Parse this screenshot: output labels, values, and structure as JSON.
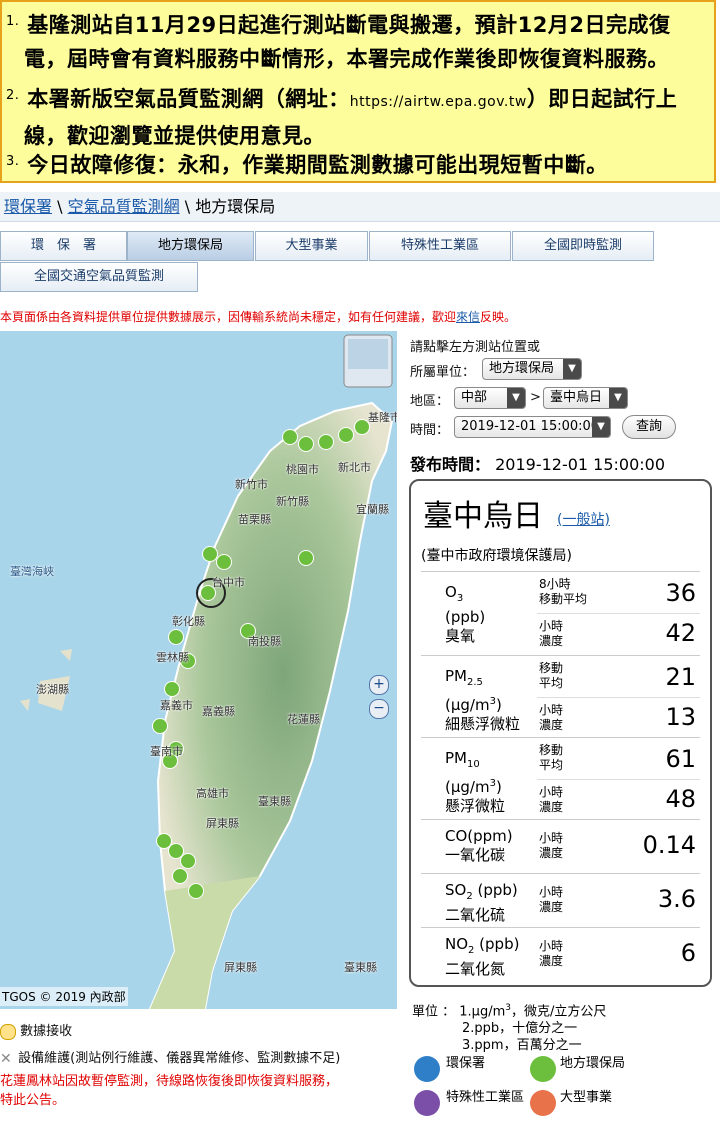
{
  "notices": [
    {
      "num": "1.",
      "line1": "基隆測站自11月29日起進行測站斷電與搬遷，預計12月2日完成復",
      "line2": "電，屆時會有資料服務中斷情形，本署完成作業後即恢復資料服務。"
    },
    {
      "num": "2.",
      "line1a": "本署新版空氣品質監測網（網址：",
      "url": "https://airtw.epa.gov.tw",
      "line1b": "）即日起試行上",
      "line2": "線，歡迎瀏覽並提供使用意見。"
    },
    {
      "num": "3.",
      "line1": "今日故障修復：永和，作業期間監測數據可能出現短暫中斷。"
    }
  ],
  "breadcrumb": {
    "item1": "環保署",
    "sep": "\\",
    "item2": "空氣品質監測網",
    "current": "地方環保局"
  },
  "tabs": [
    "環　保　署",
    "地方環保局",
    "大型事業",
    "特殊性工業區",
    "全國即時監測",
    "全國交通空氣品質監測"
  ],
  "disclaimer": {
    "text": "本頁面係由各資料提供單位提供數據展示，因傳輸系統尚未穩定，如有任何建議，歡迎",
    "link": "來信",
    "tail": "反映。"
  },
  "map": {
    "copyright": "TGOS © 2019 內政部",
    "strait": "臺灣海峽",
    "labels": [
      "基隆市",
      "桃園市",
      "新北市",
      "新竹市",
      "新竹縣",
      "宜蘭縣",
      "苗栗縣",
      "台中市",
      "彰化縣",
      "南投縣",
      "雲林縣",
      "澎湖縣",
      "嘉義市",
      "嘉義縣",
      "花蓮縣",
      "臺南市",
      "高雄市",
      "臺東縣",
      "屏東縣",
      "屏東縣",
      "臺東縣"
    ],
    "zoom_in": "+",
    "zoom_out": "−"
  },
  "map_legend": {
    "receiving": "數據接收",
    "maintenance": "設備維護(測站例行維護、儀器異常維修、監測數據不足)",
    "notice_line1": "花蓮鳳林站因故暫停監測，待線路恢復後即恢復資料服務，",
    "notice_line2": "特此公告。"
  },
  "controls": {
    "hint": "請點擊左方測站位置或",
    "unit_label": "所屬單位：",
    "unit_value": "地方環保局",
    "region_label": "地區：",
    "region_value": "中部",
    "gt": ">",
    "station_value": "臺中烏日",
    "time_label": "時間：",
    "time_value": "2019-12-01 15:00:00",
    "query_button": "查詢"
  },
  "release": {
    "label": "發布時間：",
    "value": "2019-12-01 15:00:00"
  },
  "station": {
    "name": "臺中烏日",
    "type": "(一般站)",
    "agency": "(臺中市政府環境保護局)",
    "pollutants": [
      {
        "sym": "O",
        "sub": "3",
        "unit": "(ppb)",
        "cn": "臭氧",
        "avg1": "8小時",
        "avg1b": "移動平均",
        "val1": "36",
        "avg2": "小時",
        "avg2b": "濃度",
        "val2": "42"
      },
      {
        "sym": "PM",
        "sub": "2.5",
        "unit": "(μg/m",
        "usup": "3",
        "unit_end": ")",
        "cn": "細懸浮微粒",
        "avg1": "移動",
        "avg1b": "平均",
        "val1": "21",
        "avg2": "小時",
        "avg2b": "濃度",
        "val2": "13"
      },
      {
        "sym": "PM",
        "sub": "10",
        "unit": "(μg/m",
        "usup": "3",
        "unit_end": ")",
        "cn": "懸浮微粒",
        "avg1": "移動",
        "avg1b": "平均",
        "val1": "61",
        "avg2": "小時",
        "avg2b": "濃度",
        "val2": "48"
      },
      {
        "sym": "CO(ppm)",
        "cn": "一氧化碳",
        "avg": "小時",
        "avgb": "濃度",
        "val": "0.14"
      },
      {
        "sym": "SO",
        "sub": "2",
        "symtail": " (ppb)",
        "cn": "二氧化硫",
        "avg": "小時",
        "avgb": "濃度",
        "val": "3.6"
      },
      {
        "sym": "NO",
        "sub": "2",
        "symtail": " (ppb)",
        "cn": "二氧化氮",
        "avg": "小時",
        "avgb": "濃度",
        "val": "6"
      }
    ]
  },
  "units": {
    "label": "單位 ：",
    "u1a": "1.μg/m",
    "u1sup": "3",
    "u1b": "，微克/立方公尺",
    "u2": "2.ppb，十億分之一",
    "u3": "3.ppm，百萬分之一"
  },
  "icon_legend": {
    "epa": "環保署",
    "local": "地方環保局",
    "industrial": "特殊性工業區",
    "large": "大型事業"
  },
  "colors": {
    "notice_bg": "#fdfd9b",
    "notice_border": "#e6a21b",
    "link": "#1a5aa8",
    "alert_red": "#e00000",
    "local_station": "#6cbf3c",
    "epa_station": "#2f7fc8",
    "industrial_station": "#7b4ea8",
    "large_station": "#e8734a"
  }
}
